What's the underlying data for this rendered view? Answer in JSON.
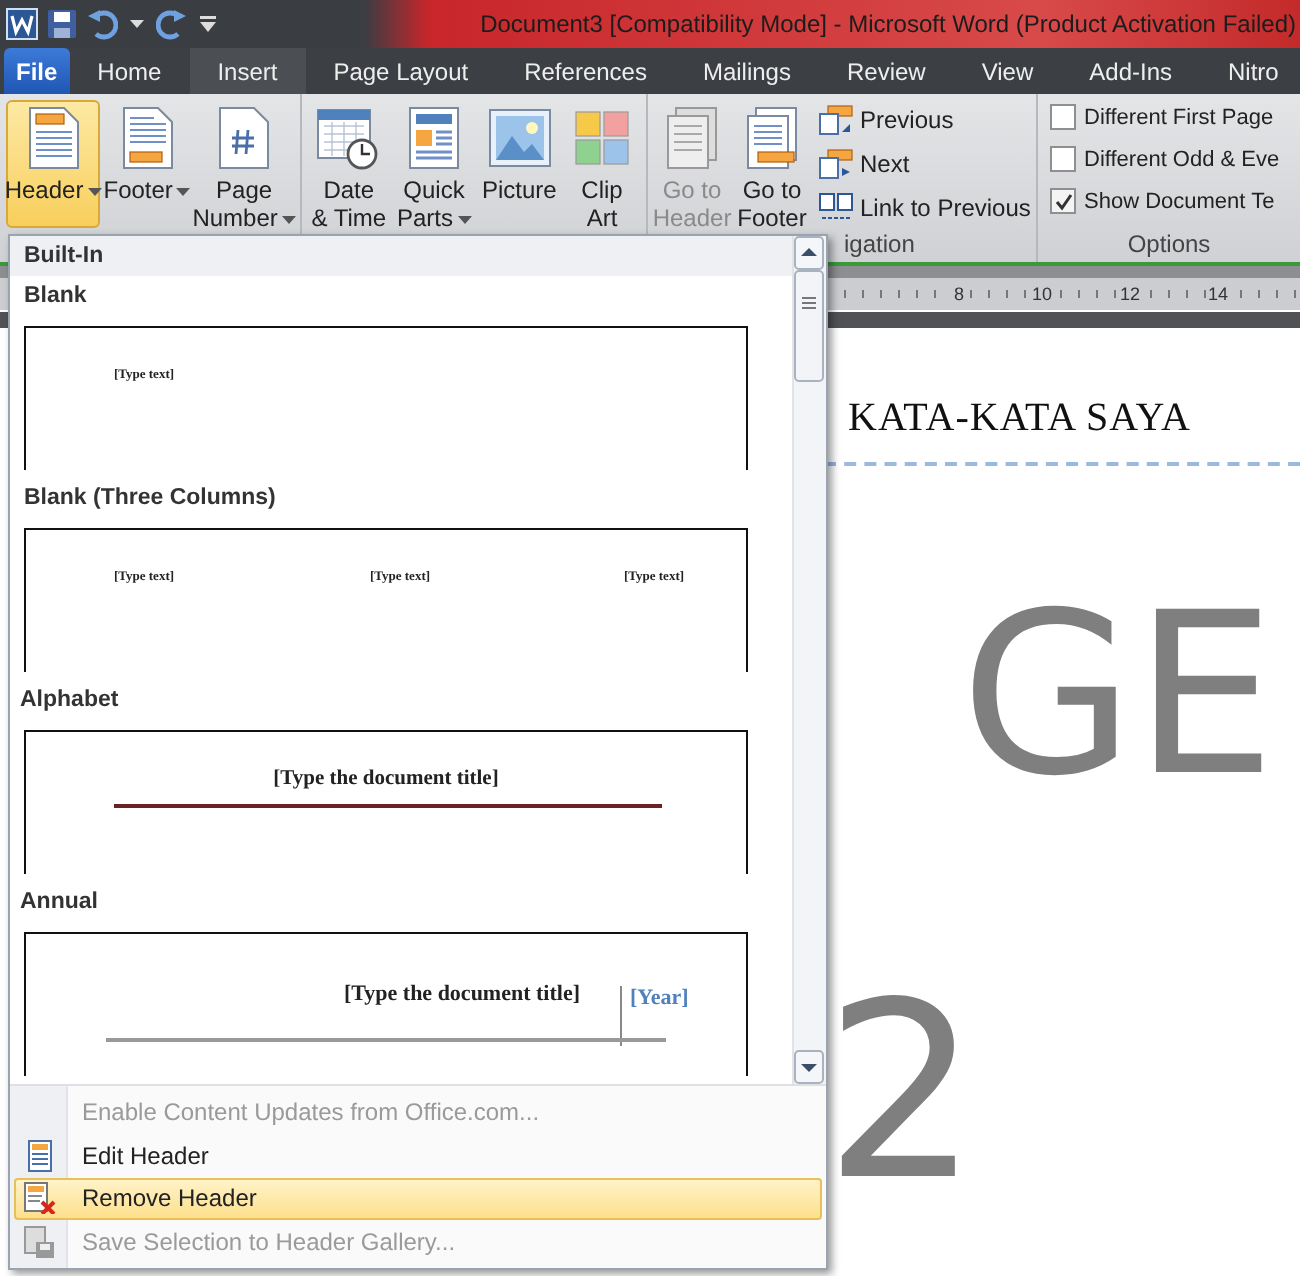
{
  "title_bar": {
    "title": "Document3 [Compatibility Mode]  -  Microsoft Word (Product Activation Failed)"
  },
  "file_tab": "File",
  "tabs": [
    {
      "label": "Home",
      "selected": false
    },
    {
      "label": "Insert",
      "selected": true
    },
    {
      "label": "Page Layout",
      "selected": false
    },
    {
      "label": "References",
      "selected": false
    },
    {
      "label": "Mailings",
      "selected": false
    },
    {
      "label": "Review",
      "selected": false
    },
    {
      "label": "View",
      "selected": false
    },
    {
      "label": "Add-Ins",
      "selected": false
    },
    {
      "label": "Nitro",
      "selected": false
    }
  ],
  "ribbon": {
    "groups": [
      {
        "buttons": [
          {
            "label": "Header",
            "dropdown": true,
            "pressed": true,
            "disabled": false
          },
          {
            "label": "Footer",
            "dropdown": true,
            "pressed": false,
            "disabled": false
          },
          {
            "label": "Page\nNumber",
            "dropdown": true,
            "pressed": false,
            "disabled": false
          }
        ]
      },
      {
        "buttons": [
          {
            "label": "Date\n& Time",
            "dropdown": false,
            "pressed": false,
            "disabled": false
          },
          {
            "label": "Quick\nParts",
            "dropdown": true,
            "pressed": false,
            "disabled": false
          },
          {
            "label": "Picture",
            "dropdown": false,
            "pressed": false,
            "disabled": false
          },
          {
            "label": "Clip\nArt",
            "dropdown": false,
            "pressed": false,
            "disabled": false
          }
        ]
      },
      {
        "label": "igation",
        "buttons": [
          {
            "label": "Go to\nHeader",
            "pressed": false,
            "disabled": true
          },
          {
            "label": "Go to\nFooter",
            "pressed": false,
            "disabled": false
          }
        ],
        "small_buttons": [
          {
            "label": "Previous"
          },
          {
            "label": "Next"
          },
          {
            "label": "Link to Previous"
          }
        ]
      },
      {
        "label": "Options",
        "checkboxes": [
          {
            "label": "Different First Page",
            "checked": false
          },
          {
            "label": "Different Odd & Eve",
            "checked": false
          },
          {
            "label": "Show Document Te",
            "checked": true
          }
        ]
      }
    ]
  },
  "ruler": {
    "numbers": [
      "8",
      "10",
      "12",
      "14"
    ]
  },
  "document": {
    "heading": "KATA-KATA SAYA",
    "big_text": "GE",
    "page_number": "2"
  },
  "dropdown": {
    "section": "Built-In",
    "gallery": [
      {
        "kind": "blank",
        "label": "Blank",
        "texts": [
          "[Type text]"
        ]
      },
      {
        "kind": "columns",
        "label": "Blank (Three Columns)",
        "texts": [
          "[Type text]",
          "[Type text]",
          "[Type text]"
        ]
      },
      {
        "kind": "alphabet",
        "label": "Alphabet",
        "texts": [
          "[Type the document title]"
        ]
      },
      {
        "kind": "annual",
        "label": "Annual",
        "texts": [
          "[Type the document title]",
          "[Year]"
        ]
      }
    ],
    "menu": [
      {
        "label": "Enable Content Updates from Office.com...",
        "disabled": true,
        "selected": false
      },
      {
        "label": "Edit Header",
        "disabled": false,
        "selected": false
      },
      {
        "label": "Remove Header",
        "disabled": false,
        "selected": true
      },
      {
        "label": "Save Selection to Header Gallery...",
        "disabled": true,
        "selected": false
      }
    ]
  }
}
